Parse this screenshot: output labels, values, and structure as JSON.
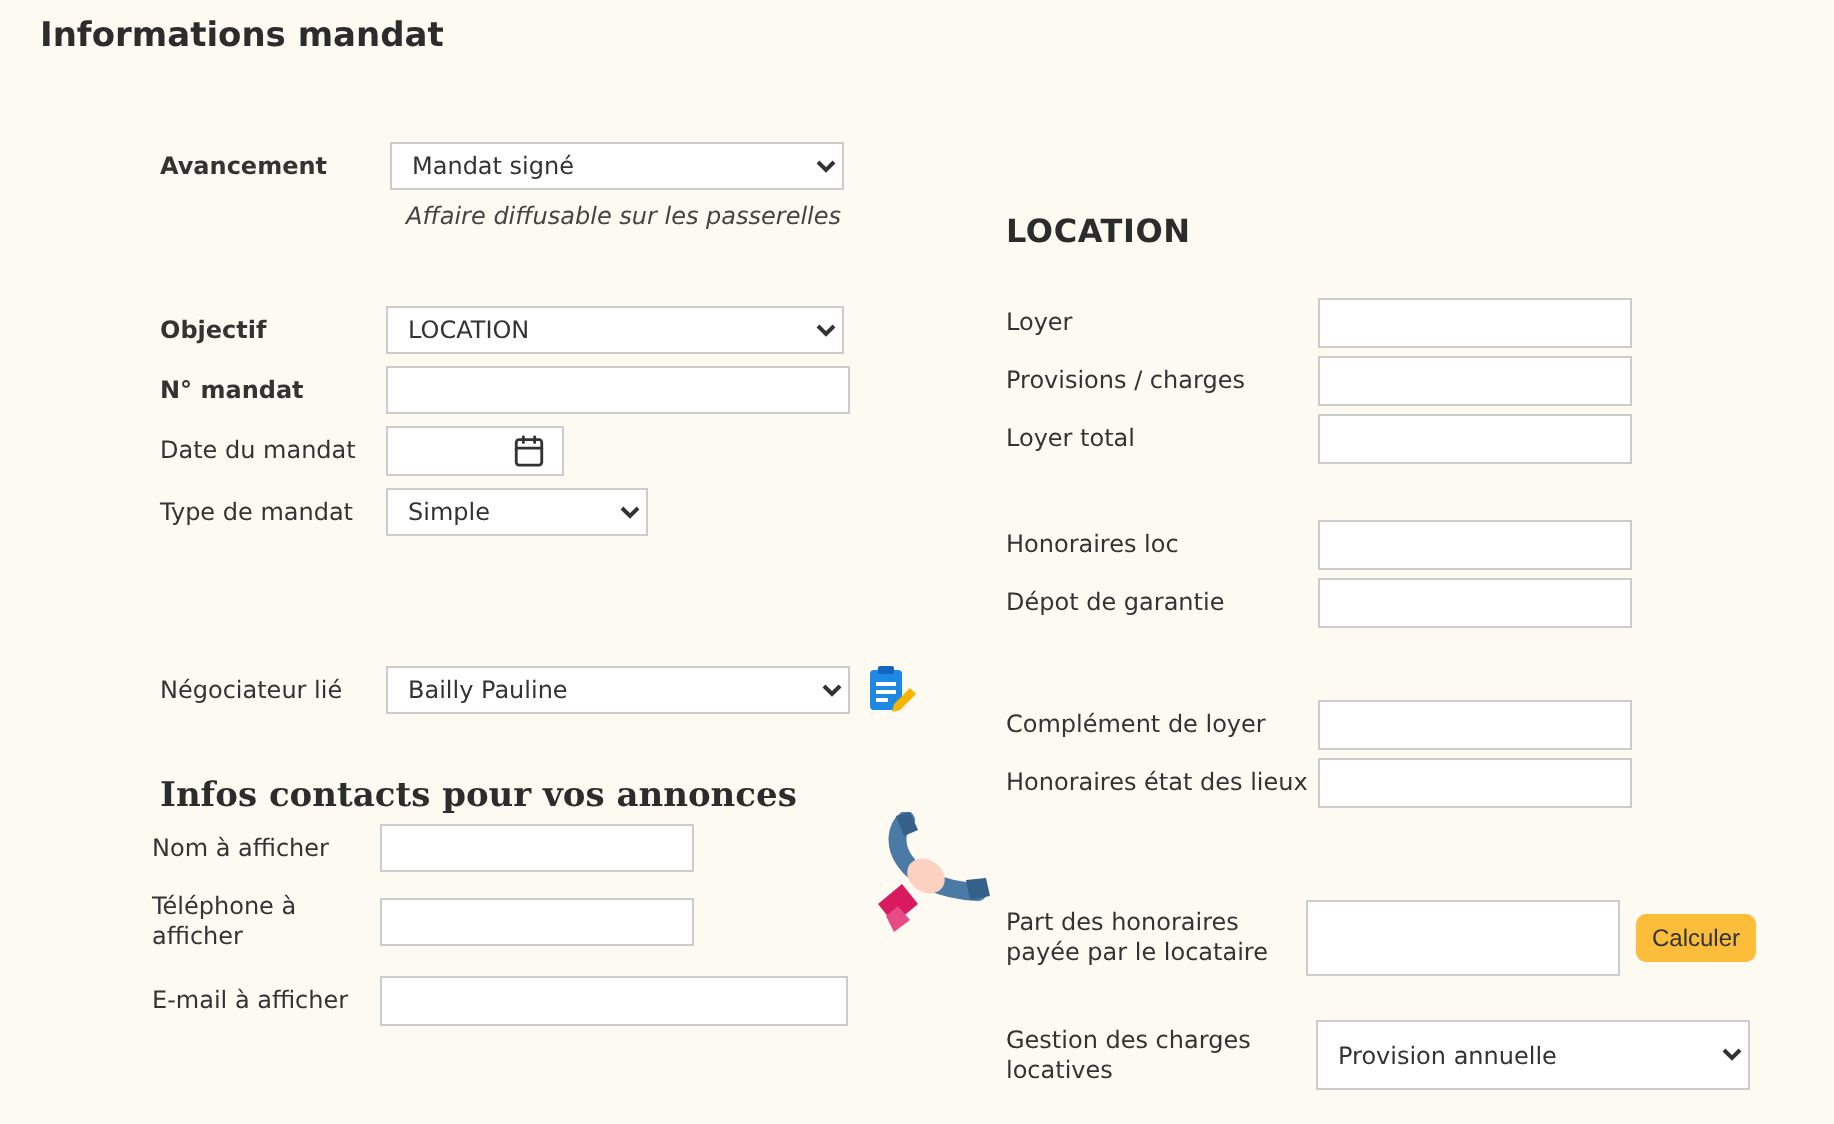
{
  "title": "Informations mandat",
  "left": {
    "avancement": {
      "label": "Avancement",
      "bold": true,
      "kind": "select",
      "value": "Mandat signé",
      "note": "Affaire diffusable sur les passerelles"
    },
    "mandate_fields": [
      {
        "label": "Objectif",
        "bold": true,
        "kind": "select",
        "value": "LOCATION"
      },
      {
        "label": "N° mandat",
        "bold": true,
        "kind": "input"
      },
      {
        "label": "Date du mandat",
        "bold": false,
        "kind": "date"
      },
      {
        "label": "Type de mandat",
        "bold": false,
        "kind": "select",
        "value": "Simple"
      }
    ],
    "negociateur": {
      "label": "Négociateur lié",
      "bold": false,
      "kind": "select",
      "value": "Bailly Pauline"
    },
    "contacts": {
      "title": "Infos contacts pour vos annonces",
      "fields": [
        {
          "label": "Nom à afficher",
          "bold": false,
          "kind": "input"
        },
        {
          "label": "Téléphone à afficher",
          "bold": false,
          "kind": "input"
        },
        {
          "label": "E-mail à afficher",
          "bold": false,
          "kind": "input"
        }
      ]
    }
  },
  "right": {
    "title": "LOCATION",
    "groups": [
      [
        {
          "label": "Loyer",
          "kind": "input"
        },
        {
          "label": "Provisions / charges",
          "kind": "input"
        },
        {
          "label": "Loyer total",
          "kind": "input"
        }
      ],
      [
        {
          "label": "Honoraires loc",
          "kind": "input"
        },
        {
          "label": "Dépot de garantie",
          "kind": "input"
        }
      ],
      [
        {
          "label": "Complément de loyer",
          "kind": "input"
        },
        {
          "label": "Honoraires état des lieux",
          "kind": "input"
        }
      ],
      [
        {
          "label": "Part des honoraires payée par le locataire",
          "kind": "input",
          "button": "Calculer"
        }
      ],
      [
        {
          "label": "Gestion des charges locatives",
          "kind": "select",
          "value": "Provision annuelle"
        }
      ]
    ]
  }
}
